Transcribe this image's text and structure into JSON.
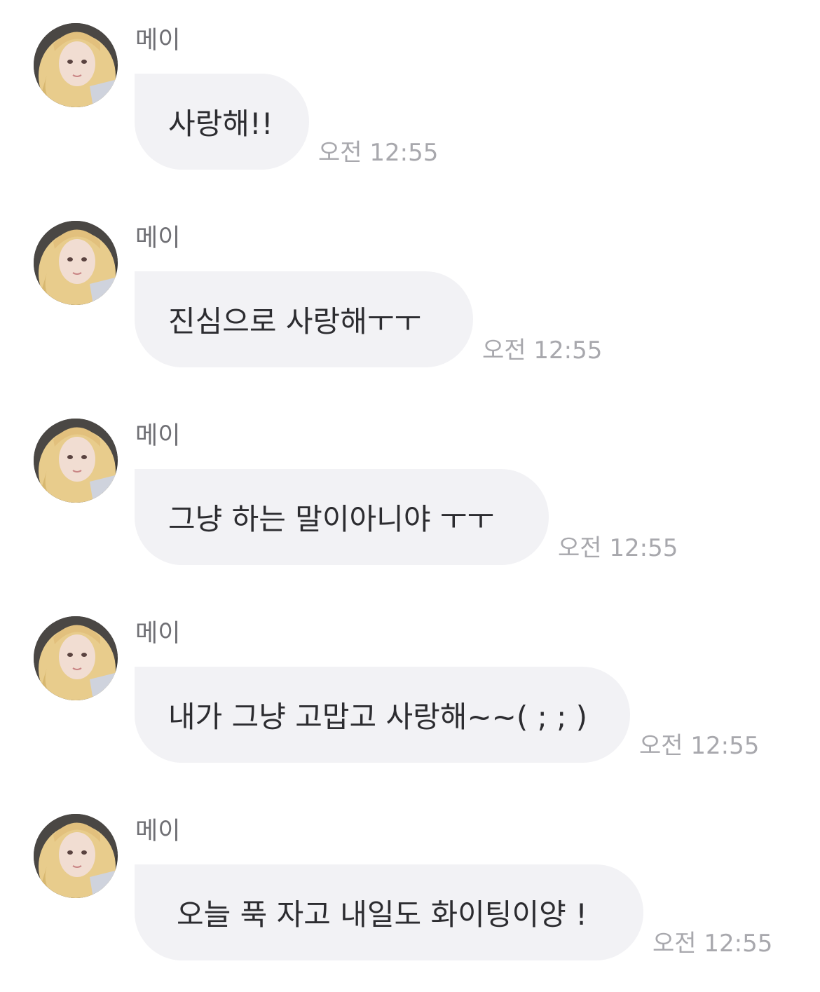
{
  "messages": [
    {
      "sender": "메이",
      "text": "사랑해!!",
      "time": "오전 12:55"
    },
    {
      "sender": "메이",
      "text": "진심으로 사랑해ㅜㅜ",
      "time": "오전 12:55"
    },
    {
      "sender": "메이",
      "text": "그냥 하는 말이아니야 ㅜㅜ",
      "time": "오전 12:55"
    },
    {
      "sender": "메이",
      "text": "내가 그냥 고맙고 사랑해~~( ; ; )",
      "time": "오전 12:55"
    },
    {
      "sender": "메이",
      "text": "오늘 푹 자고 내일도 화이팅이양 !",
      "time": "오전 12:55"
    }
  ],
  "colors": {
    "bubble": "#f2f2f5",
    "text": "#2c2c30",
    "sender": "#6f6f74",
    "time": "#a8a8ad"
  },
  "icons": {
    "avatar": "profile-photo-avatar"
  }
}
